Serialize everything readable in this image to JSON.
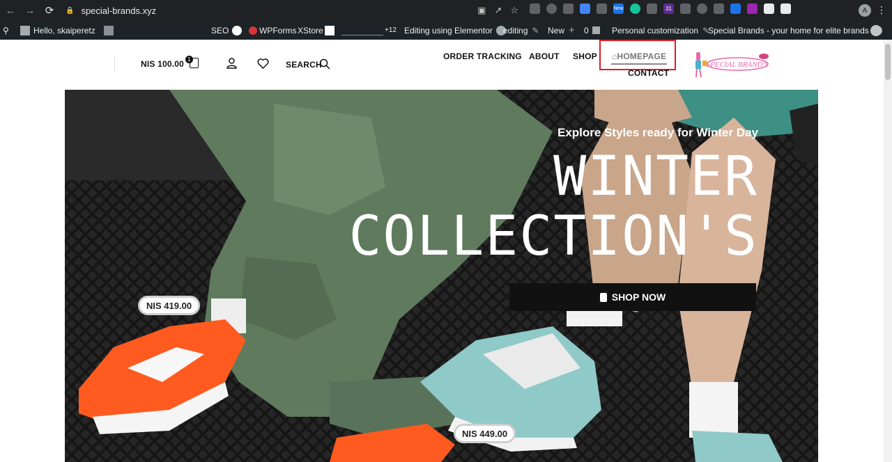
{
  "browser": {
    "url": "special-brands.xyz",
    "extension_badge_new": "New",
    "extension_badge_31": "31",
    "profile_initial": "A"
  },
  "admin_bar": {
    "greeting": "Hello, skaiperetz",
    "seo": "SEO",
    "wpforms": "WPForms",
    "xstore": "XStore",
    "stats_delta": "+12",
    "elementor": "Editing using Elementor",
    "editing": "editing",
    "new": "New",
    "comments": "0",
    "customize": "Personal customization",
    "site_name": "Special Brands - your home for elite brands"
  },
  "header": {
    "cart_total": "NIS 100.00",
    "cart_count": "1",
    "search_label": "SEARCH",
    "nav": {
      "order_tracking": "ORDER TRACKING",
      "about": "ABOUT",
      "shop": "SHOP",
      "homepage": "HOMEPAGE",
      "contact": "CONTACT"
    },
    "logo_text": "SPECIAL BRAND'S"
  },
  "hero": {
    "subtitle": "Explore Styles ready for Winter Day",
    "title_line1": "WINTER",
    "title_line2": "COLLECTION'S",
    "cta": "SHOP NOW",
    "price_left": "NIS 419.00",
    "price_bottom": "NIS 449.00"
  },
  "colors": {
    "highlight": "#e21b23",
    "wp_bar": "#1d2327",
    "chrome": "#202124"
  }
}
